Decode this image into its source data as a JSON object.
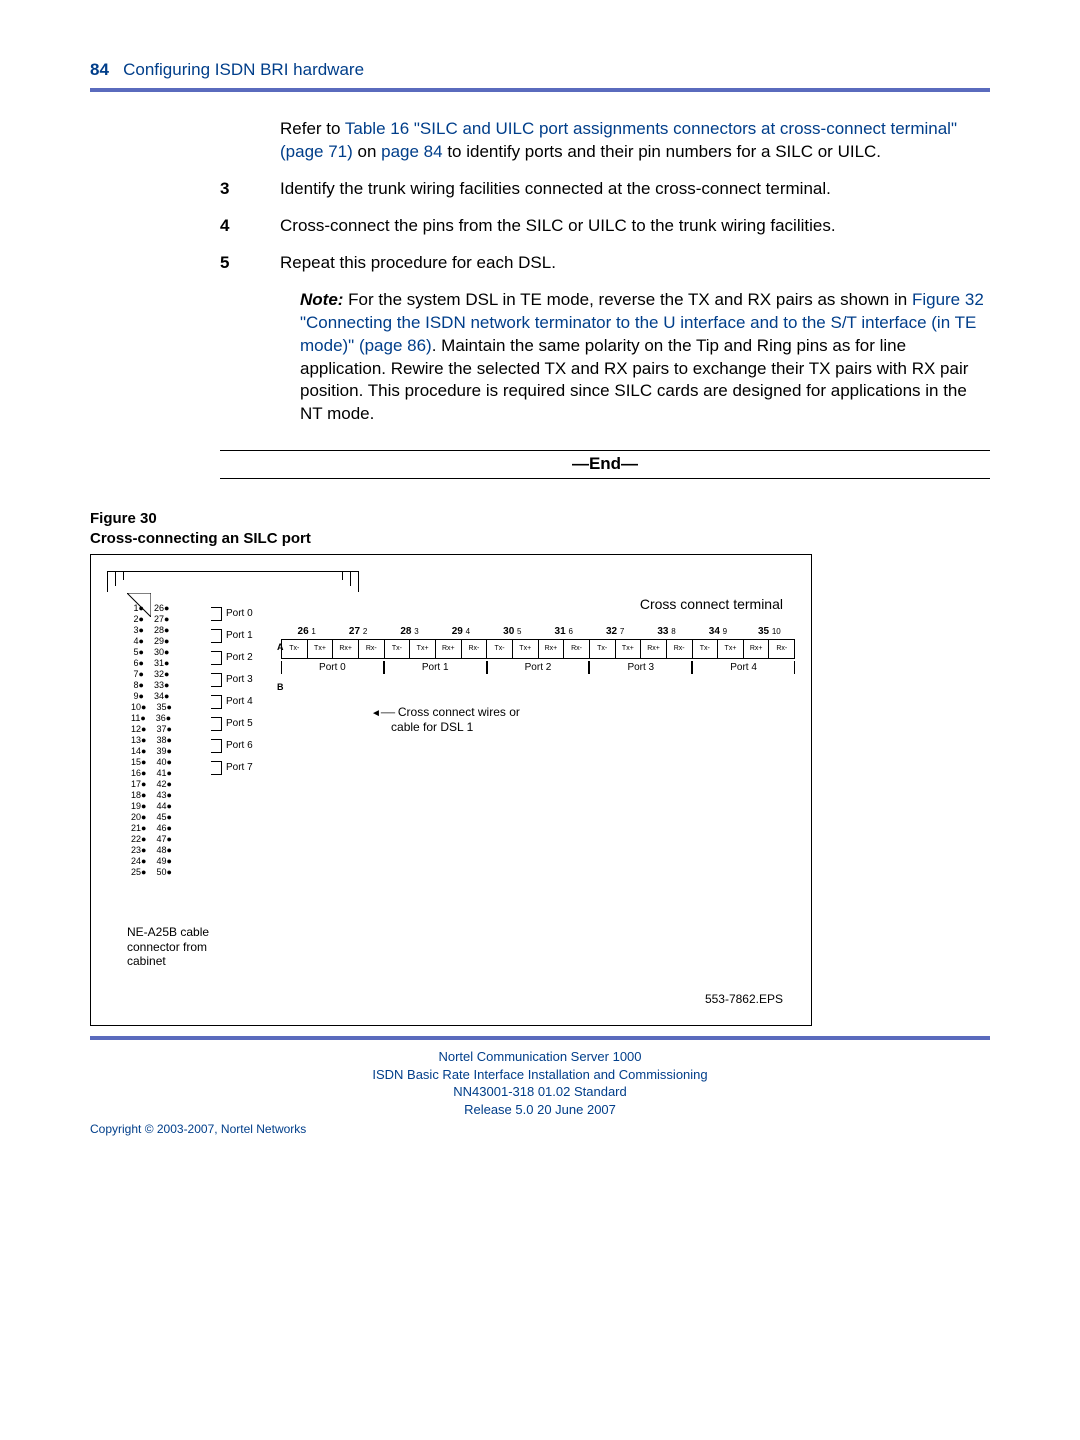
{
  "header": {
    "page_number": "84",
    "section_title": "Configuring ISDN BRI hardware"
  },
  "intro": {
    "pre_text": "Refer to ",
    "link1": "Table 16 \"SILC and UILC port assignments connectors at cross-connect terminal\" (page 71)",
    "mid_text": " on ",
    "link2": "page 84",
    "post_text": " to identify ports and their pin numbers for a SILC or UILC."
  },
  "steps": {
    "s3": {
      "num": "3",
      "text": "Identify the trunk wiring facilities connected at the cross-connect terminal."
    },
    "s4": {
      "num": "4",
      "text": "Cross-connect the pins from the SILC or UILC to the trunk wiring facilities."
    },
    "s5": {
      "num": "5",
      "text": "Repeat this procedure for each DSL."
    }
  },
  "note": {
    "label": "Note:",
    "pre": "  For the system DSL in TE mode, reverse the TX and RX pairs as shown in ",
    "link": "Figure 32 \"Connecting the ISDN network terminator to the U interface and to the S/T interface (in TE mode)\" (page 86)",
    "post": ".  Maintain the same polarity on the Tip and Ring pins as for line application.  Rewire the selected TX and RX pairs to exchange their TX pairs with RX pair position.  This procedure is required since SILC cards are designed for applications in the NT mode."
  },
  "end_marker": "—End—",
  "figure": {
    "number": "Figure 30",
    "title": "Cross-connecting an SILC port",
    "cc_label": "Cross connect terminal",
    "cable_label_l1": "NE-A25B cable",
    "cable_label_l2": "connector from",
    "cable_label_l3": "cabinet",
    "cross_note_l1": "Cross connect wires or",
    "cross_note_l2": "cable for DSL 1",
    "eps": "553-7862.EPS",
    "left_pins_l": [
      "1",
      "2",
      "3",
      "4",
      "5",
      "6",
      "7",
      "8",
      "9",
      "10",
      "11",
      "12",
      "13",
      "14",
      "15",
      "16",
      "17",
      "18",
      "19",
      "20",
      "21",
      "22",
      "23",
      "24",
      "25"
    ],
    "left_pins_r": [
      "26",
      "27",
      "28",
      "29",
      "30",
      "31",
      "32",
      "33",
      "34",
      "35",
      "36",
      "37",
      "38",
      "39",
      "40",
      "41",
      "42",
      "43",
      "44",
      "45",
      "46",
      "47",
      "48",
      "49",
      "50"
    ],
    "port_list": [
      "Port 0",
      "Port 1",
      "Port 2",
      "Port 3",
      "Port 4",
      "Port 5",
      "Port 6",
      "Port 7"
    ],
    "terminal_top_bold": [
      "26",
      "27",
      "28",
      "29",
      "30",
      "31",
      "32",
      "33",
      "34",
      "35"
    ],
    "terminal_top_small": [
      "1",
      "2",
      "3",
      "4",
      "5",
      "6",
      "7",
      "8",
      "9",
      "10"
    ],
    "terminal_cells": [
      "Tx-",
      "Tx+",
      "Rx+",
      "Rx-",
      "Tx-",
      "Tx+",
      "Rx+",
      "Rx-",
      "Tx-",
      "Tx+",
      "Rx+",
      "Rx-",
      "Tx-",
      "Tx+",
      "Rx+",
      "Rx-",
      "Tx-",
      "Tx+",
      "Rx+",
      "Rx-"
    ],
    "terminal_ports": [
      "Port 0",
      "Port 1",
      "Port 2",
      "Port 3",
      "Port 4"
    ],
    "lead_a": "A",
    "lead_b": "B"
  },
  "footer": {
    "l1": "Nortel Communication Server 1000",
    "l2": "ISDN Basic Rate Interface Installation and Commissioning",
    "l3": "NN43001-318   01.02   Standard",
    "l4": "Release 5.0    20 June 2007",
    "copyright": "Copyright © 2003-2007, Nortel Networks"
  }
}
